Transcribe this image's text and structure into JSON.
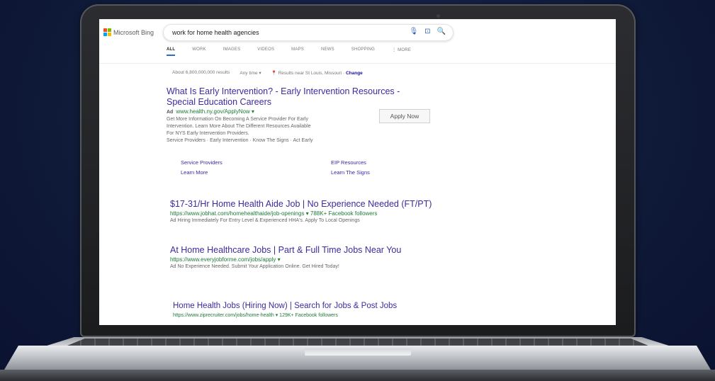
{
  "brand": {
    "logo_text": "Microsoft Bing",
    "colors": [
      "#f25022",
      "#7fba00",
      "#00a4ef",
      "#ffb900"
    ]
  },
  "search": {
    "query": "work for home health agencies",
    "icons": [
      "microphone-icon",
      "visual-search-icon",
      "search-icon"
    ]
  },
  "tabs": [
    "ALL",
    "WORK",
    "IMAGES",
    "VIDEOS",
    "MAPS",
    "NEWS",
    "SHOPPING",
    "⋮ MORE"
  ],
  "meta": {
    "results_count": "About 6,800,000,000 results",
    "time_filter": "Any time ▾",
    "location": "Results near St Louis, Missouri ·",
    "change": "Change"
  },
  "results": [
    {
      "title_line1": "What Is Early Intervention? - Early Intervention Resources -",
      "title_line2": "Special Education Careers",
      "ad_label": "Ad",
      "url": "www.health.ny.gov/ApplyNow ▾",
      "desc1": "Get More Information On Becoming A Service Provider For Early",
      "desc2": "Intervention. Learn More About The Different Resources Available",
      "desc3": "For NYS Early Intervention Providers.",
      "desc4": "Service Providers · Early Intervention · Know The Signs · Act Early",
      "sitelinks": [
        "Service Providers",
        "EIP Resources",
        "Learn More",
        "Learn The Signs"
      ],
      "button": "Apply Now"
    },
    {
      "title": "$17-31/Hr Home Health Aide Job | No Experience Needed (FT/PT)",
      "url": "https://www.jobhat.com/homehealthaide/job-openings ▾  788K+ Facebook followers",
      "desc": "Ad Hiring Immediately For Entry Level & Experienced HHA's. Apply To Local Openings"
    },
    {
      "title": "At Home Healthcare Jobs | Part & Full Time Jobs Near You",
      "url": "https://www.everyjobforme.com/jobs/apply ▾",
      "desc": "Ad No Experience Needed. Submit Your Application Online. Get Hired Today!"
    },
    {
      "title": "Home Health Jobs (Hiring Now) | Search for Jobs & Post Jobs",
      "url": "https://www.ziprecruiter.com/jobs/home-health ▾  129K+ Facebook followers"
    }
  ]
}
